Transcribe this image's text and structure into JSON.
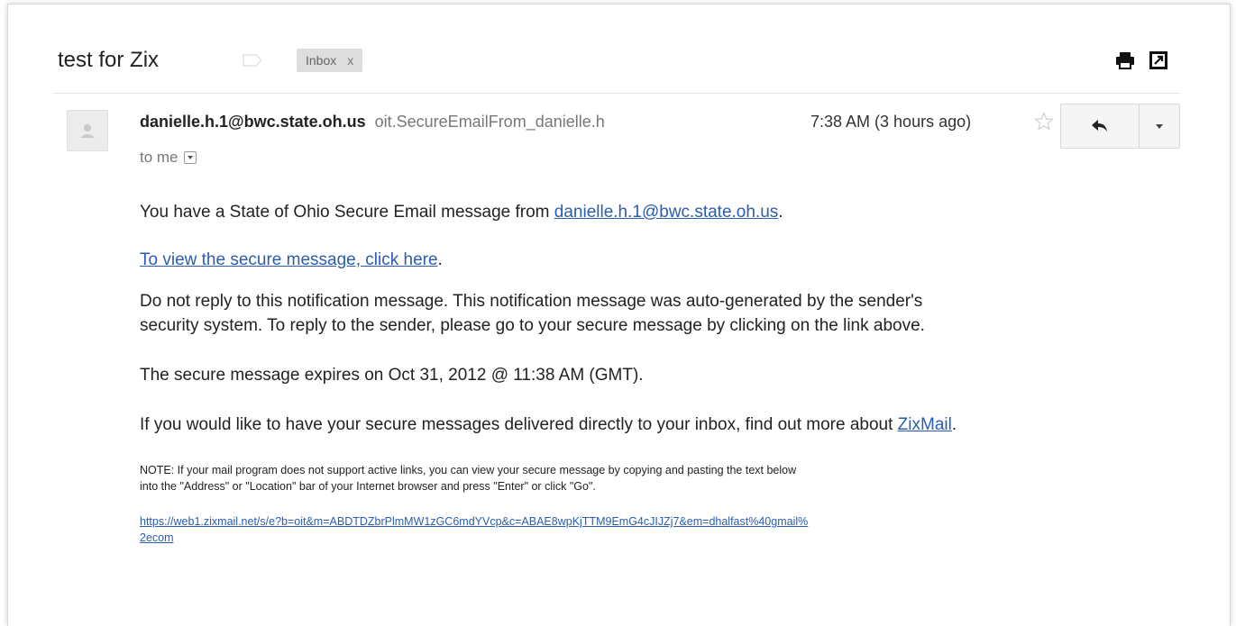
{
  "thread": {
    "subject": "test for Zix",
    "label": "Inbox",
    "label_remove": "x"
  },
  "message": {
    "sender_email": "danielle.h.1@bwc.state.oh.us",
    "sender_alias": "oit.SecureEmailFrom_danielle.h",
    "to_line": "to me",
    "timestamp": "7:38 AM (3 hours ago)",
    "body": {
      "line1_prefix": "You have a State of Ohio Secure Email message from ",
      "line1_link": "danielle.h.1@bwc.state.oh.us",
      "line1_suffix": ".",
      "view_link": "To view the secure message, click here",
      "view_suffix": ".",
      "notice_line1": "Do not reply to this notification message. This notification message was auto-generated by the sender's",
      "notice_line2": "security system. To reply to the sender, please go to your secure message by clicking on the link above.",
      "expires": "The secure message expires on Oct 31, 2012 @ 11:38 AM (GMT).",
      "zix_prefix": "If you would like to have your secure messages delivered directly to your inbox, find out more about ",
      "zix_link": "ZixMail",
      "zix_suffix": ".",
      "note_line1": "NOTE: If your mail program does not support active links, you can view your secure message by copying and pasting the text below",
      "note_line2": "into the \"Address\" or \"Location\" bar of your Internet browser and press \"Enter\" or click \"Go\".",
      "url_line1": "https://web1.zixmail.net/s/e?b=oit&m=ABDTDZbrPlmMW1zGC6mdYVcp&c=ABAE8wpKjTTM9EmG4cJIJZj7&em=dhalfast%40gmail%",
      "url_line2": "2ecom"
    }
  },
  "icons": {
    "print": "printer-icon",
    "new_window": "open-in-new-window-icon",
    "star": "star-icon",
    "reply": "reply-arrow-icon",
    "more": "chevron-down-icon",
    "avatar": "default-avatar-icon",
    "label": "label-tag-icon"
  },
  "colors": {
    "link": "#2a5db0",
    "secondary_text": "#777777",
    "badge_bg": "#dddddd"
  }
}
